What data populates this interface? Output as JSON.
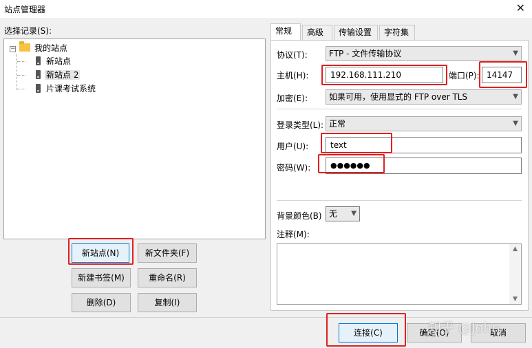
{
  "window": {
    "title": "站点管理器",
    "close_glyph": "✕"
  },
  "left": {
    "select_label": "选择记录(S):",
    "tree": {
      "root_label": "我的站点",
      "expander": "−",
      "items": [
        "新站点",
        "新站点 2",
        "片课考试系统"
      ],
      "selected_index": 1
    },
    "buttons": {
      "new_site": "新站点(N)",
      "new_folder": "新文件夹(F)",
      "new_bookmark": "新建书签(M)",
      "rename": "重命名(R)",
      "delete": "删除(D)",
      "copy": "复制(I)"
    }
  },
  "tabs": [
    "常规",
    "高级",
    "传输设置",
    "字符集"
  ],
  "active_tab": 0,
  "general": {
    "protocol_label": "协议(T):",
    "protocol_value": "FTP - 文件传输协议",
    "host_label": "主机(H):",
    "host_value": "192.168.111.210",
    "port_label": "端口(P):",
    "port_value": "14147",
    "encryption_label": "加密(E):",
    "encryption_value": "如果可用，使用显式的 FTP over TLS",
    "logon_type_label": "登录类型(L):",
    "logon_type_value": "正常",
    "user_label": "用户(U):",
    "user_value": "text",
    "password_label": "密码(W):",
    "password_value": "●●●●●●",
    "bg_color_label": "背景颜色(B)",
    "bg_color_value": "无",
    "comments_label": "注释(M):"
  },
  "footer": {
    "connect": "连接(C)",
    "ok": "确定(O)",
    "cancel": "取消"
  },
  "watermark": "知乎 @John",
  "colors": {
    "highlight_box": "#e02020",
    "focus_border": "#0078d7"
  }
}
